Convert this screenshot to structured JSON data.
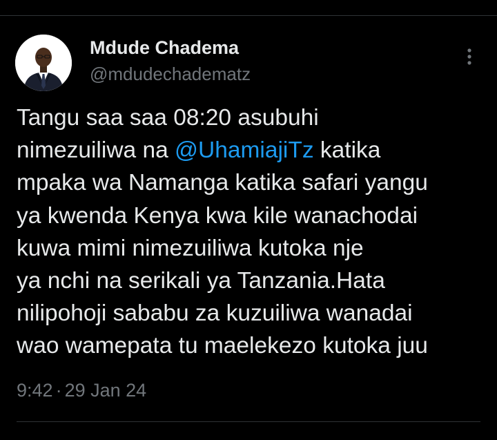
{
  "author": {
    "display_name": "Mdude Chadema",
    "handle": "@mdudechadematz"
  },
  "tweet": {
    "line1": "Tangu saa saa 08:20 asubuhi",
    "line2_before": "nimezuiliwa na ",
    "line2_mention": "@UhamiajiTz",
    "line2_after": " katika",
    "line3": "mpaka wa Namanga katika safari yangu",
    "line4": "ya kwenda Kenya kwa kile wanachodai",
    "line5": "kuwa mimi nimezuiliwa kutoka nje",
    "line6": "ya nchi na serikali ya Tanzania.Hata",
    "line7": "nilipohoji sababu za kuzuiliwa wanadai",
    "line8": "wao wamepata tu maelekezo kutoka juu"
  },
  "meta": {
    "time": "9:42",
    "separator": "·",
    "date": "29 Jan 24"
  },
  "colors": {
    "background": "#000000",
    "text": "#e7e9ea",
    "secondary_text": "#71767b",
    "mention": "#1d9bf0",
    "divider": "#2f3336"
  },
  "icons": {
    "more": "more-vertical-icon"
  }
}
